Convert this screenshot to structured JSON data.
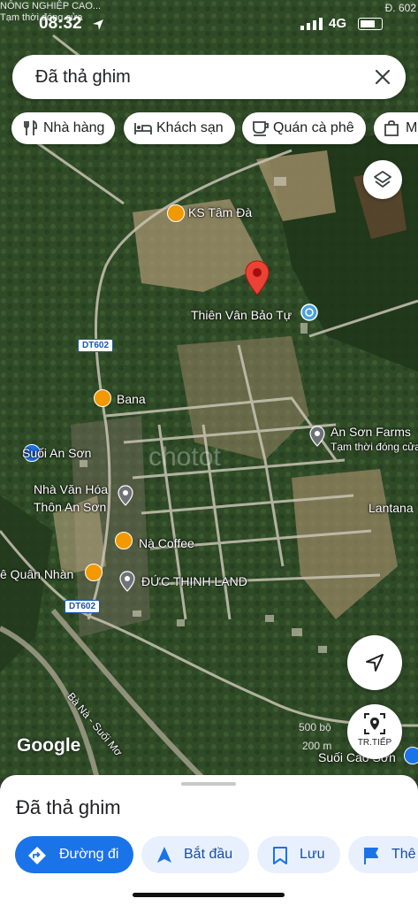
{
  "status_bar": {
    "time": "08:32",
    "network": "4G",
    "top_label": "NÔNG NGHIỆP CAO...",
    "sub_label": "Tạm thời đóng cửa",
    "road_top": "Đ. 602"
  },
  "search": {
    "text": "Đã thả ghim"
  },
  "chips": [
    {
      "label": "Nhà hàng",
      "icon": "fork-knife-icon"
    },
    {
      "label": "Khách sạn",
      "icon": "bed-icon"
    },
    {
      "label": "Quán cà phê",
      "icon": "coffee-cup-icon"
    },
    {
      "label": "M",
      "icon": "shopping-bag-icon"
    }
  ],
  "map_labels": {
    "ks_tam_da": "KS Tâm Đà",
    "thien_van": "Thiên Vân Bảo Tự",
    "dt602_a": "DT602",
    "bana": "Bana",
    "suoi_an_son": "Suối An Sơn",
    "an_son_farms": "An Sơn Farms",
    "an_son_farms_status": "Tạm thời đóng cửa",
    "nha_van_hoa_1": "Nhà Văn Hóa",
    "nha_van_hoa_2": "Thôn An Sơn",
    "lantana": "Lantana",
    "na_coffee": "Nà Coffee",
    "quan_nhan": "ê Quân Nhàn",
    "duc_thinh": "ĐỨC THỊNH LAND",
    "dt602_b": "DT602",
    "ba_na_road": "Bà Nà - Suối Mơ",
    "suoi_cao_son": "Suối Cao Sơn",
    "watermark": "chotot"
  },
  "map_controls": {
    "street_view_label": "TR.TIẾP",
    "scale_label_1": "500 bộ",
    "scale_label_2": "200 m",
    "google_logo": "Google"
  },
  "bottom_sheet": {
    "title": "Đã thả ghim",
    "actions": [
      {
        "label": "Đường đi",
        "icon": "directions-icon",
        "primary": true
      },
      {
        "label": "Bắt đầu",
        "icon": "navigation-arrow-icon",
        "primary": false
      },
      {
        "label": "Lưu",
        "icon": "bookmark-icon",
        "primary": false
      },
      {
        "label": "Thê",
        "icon": "flag-icon",
        "primary": false
      }
    ]
  },
  "colors": {
    "primary_blue": "#1a73e8",
    "chip_blue_bg": "#e8f0fe",
    "pin_red": "#ea4335",
    "food_orange": "#f29900",
    "poi_grey": "#6f7378",
    "attraction_blue": "#1a73e8"
  }
}
